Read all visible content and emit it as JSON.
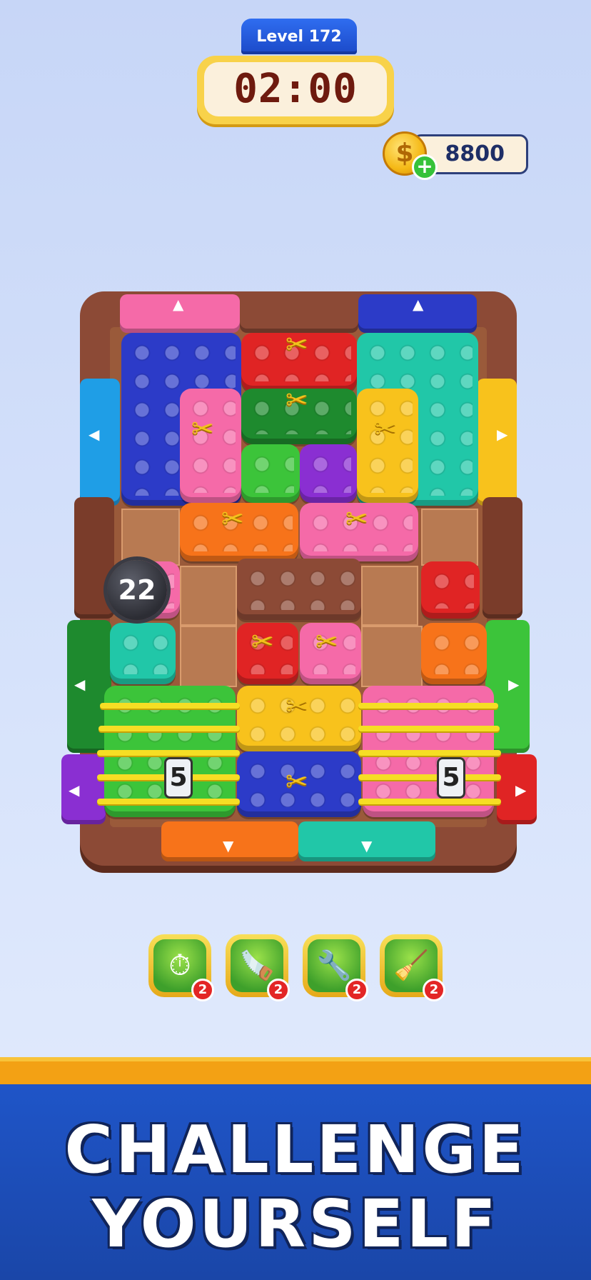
{
  "hud": {
    "level_label": "Level 172",
    "timer": "02:00",
    "coins": "8800"
  },
  "board": {
    "bomb_count": "22",
    "rope_lock_left": "5",
    "rope_lock_right": "5"
  },
  "boosters": [
    {
      "name": "clock-booster",
      "count": "2"
    },
    {
      "name": "saw-booster",
      "count": "2"
    },
    {
      "name": "drill-booster",
      "count": "2"
    },
    {
      "name": "vacuum-booster",
      "count": "2"
    }
  ],
  "banner": {
    "line1": "CHALLENGE",
    "line2": "YOURSELF"
  },
  "colors": {
    "blue": "#2c3bc8",
    "red": "#e02424",
    "teal": "#21c7a8",
    "pink": "#f56aa8",
    "darkgreen": "#1e8a2e",
    "green": "#3cc43a",
    "yellow": "#f8c21c",
    "purple": "#8a2fd2",
    "orange": "#f7731a",
    "brown": "#8c4a36"
  }
}
